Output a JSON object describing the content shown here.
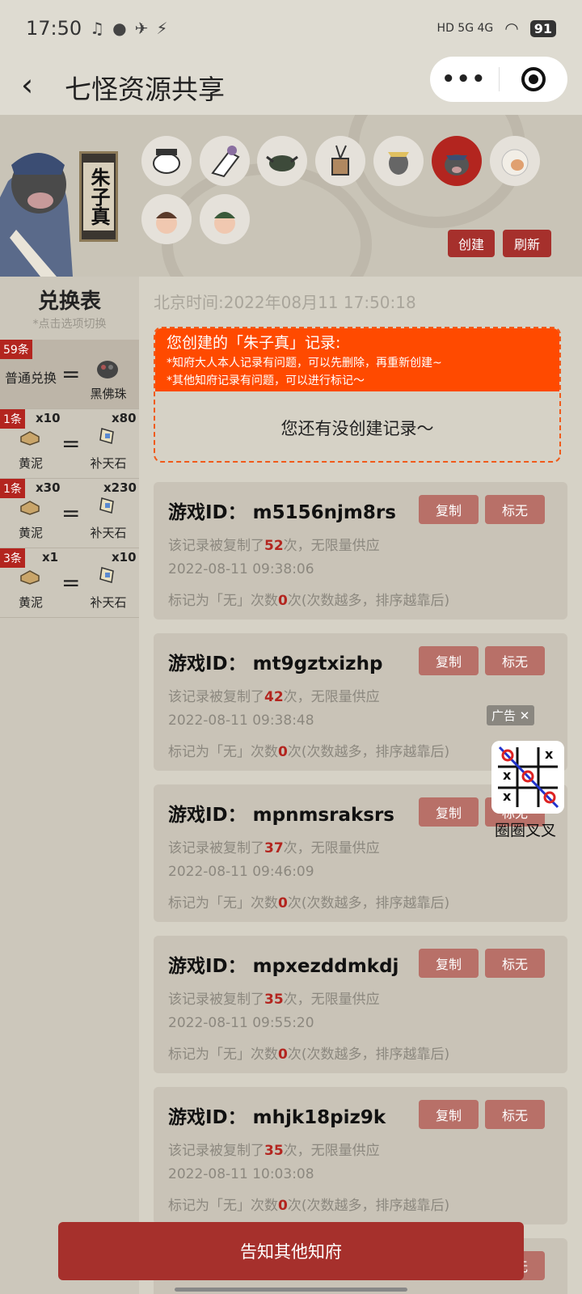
{
  "status_bar": {
    "time": "17:50",
    "network": "HD 5G 4G",
    "battery": "91"
  },
  "nav": {
    "back": "‹",
    "title": "七怪资源共享",
    "more": "•••"
  },
  "banner": {
    "character_name": "朱子真",
    "create_label": "创建",
    "refresh_label": "刷新",
    "avatar_count": 9
  },
  "sidebar": {
    "title": "兑换表",
    "subtitle": "*点击选项切换",
    "rows": [
      {
        "badge": "59条",
        "left_label": "普通兑换",
        "eq": "=",
        "right_name": "黑佛珠"
      },
      {
        "badge": "1条",
        "left_qty": "x10",
        "left_name": "黄泥",
        "eq": "=",
        "right_qty": "x80",
        "right_name": "补天石"
      },
      {
        "badge": "1条",
        "left_qty": "x30",
        "left_name": "黄泥",
        "eq": "=",
        "right_qty": "x230",
        "right_name": "补天石"
      },
      {
        "badge": "3条",
        "left_qty": "x1",
        "left_name": "黄泥",
        "eq": "=",
        "right_qty": "x10",
        "right_name": "补天石"
      }
    ]
  },
  "main": {
    "beijing_time": "北京时间:2022年08月11 17:50:18",
    "mine": {
      "heading": "您创建的「朱子真」记录:",
      "note1": "*知府大人本人记录有问题，可以先删除，再重新创建~",
      "note2": "*其他知府记录有问题，可以进行标记〜",
      "empty": "您还有没创建记录〜"
    },
    "copy_label": "复制",
    "mark_label": "标无",
    "records": [
      {
        "id": "游戏ID：  m5156njm8rs",
        "copied_pre": "该记录被复制了",
        "copied": "52",
        "copied_post": "次，无限量供应",
        "time": "2022-08-11 09:38:06",
        "mark_pre": "标记为「无」次数",
        "mark": "0",
        "mark_post": "次(次数越多，排序越靠后)"
      },
      {
        "id": "游戏ID：  mt9gztxizhp",
        "copied_pre": "该记录被复制了",
        "copied": "42",
        "copied_post": "次，无限量供应",
        "time": "2022-08-11 09:38:48",
        "mark_pre": "标记为「无」次数",
        "mark": "0",
        "mark_post": "次(次数越多，排序越靠后)"
      },
      {
        "id": "游戏ID：  mpnmsraksrs",
        "copied_pre": "该记录被复制了",
        "copied": "37",
        "copied_post": "次，无限量供应",
        "time": "2022-08-11 09:46:09",
        "mark_pre": "标记为「无」次数",
        "mark": "0",
        "mark_post": "次(次数越多，排序越靠后)"
      },
      {
        "id": "游戏ID：  mpxezddmkdj",
        "copied_pre": "该记录被复制了",
        "copied": "35",
        "copied_post": "次，无限量供应",
        "time": "2022-08-11 09:55:20",
        "mark_pre": "标记为「无」次数",
        "mark": "0",
        "mark_post": "次(次数越多，排序越靠后)"
      },
      {
        "id": "游戏ID：  mhjk18piz9k",
        "copied_pre": "该记录被复制了",
        "copied": "35",
        "copied_post": "次，无限量供应",
        "time": "2022-08-11 10:03:08",
        "mark_pre": "标记为「无」次数",
        "mark": "0",
        "mark_post": "次(次数越多，排序越靠后)"
      }
    ]
  },
  "ad": {
    "tag": "广告 ✕",
    "name": "圈圈叉叉"
  },
  "footer": {
    "notify_label": "告知其他知府"
  }
}
